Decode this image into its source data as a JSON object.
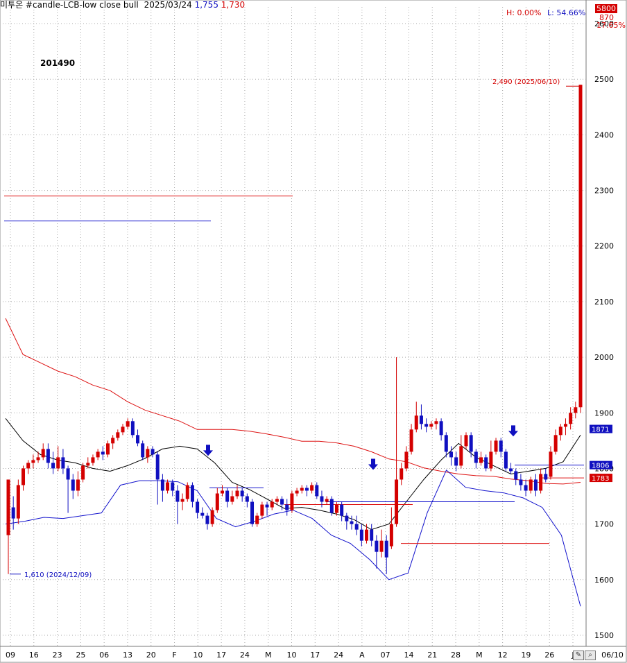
{
  "header": {
    "title": "미투온 #candle-LCB-low close bull",
    "date": "2025/03/24",
    "price1": "1,755",
    "price2": "1,730"
  },
  "code": "201490",
  "stats": {
    "high": "H: 0.00%",
    "low": "L: 54.66%",
    "pct": "17.65%",
    "val_5800": "5800",
    "val_870": "870"
  },
  "annotations": {
    "max_label": "2,490 (2025/06/10)",
    "min_label": "1,610 (2024/12/09)"
  },
  "right_tags": {
    "tag1871": "1871",
    "tag1806": "1806",
    "tag1783": "1783"
  },
  "colors": {
    "up": "#d40000",
    "down": "#1010c0",
    "upper_band": "#dd1111",
    "lower_band": "#1111cc",
    "mid_line": "#000000",
    "grid": "#aaaaaa"
  },
  "chart_data": {
    "type": "candlestick",
    "ylim": [
      1480,
      2630
    ],
    "yticks": [
      1500,
      1600,
      1700,
      1800,
      1900,
      2000,
      2100,
      2200,
      2300,
      2400,
      2500,
      2600
    ],
    "xticks": [
      "09",
      "16",
      "23",
      "25",
      "06",
      "13",
      "20",
      "F",
      "10",
      "17",
      "24",
      "M",
      "10",
      "17",
      "24",
      "A",
      "07",
      "14",
      "21",
      "28",
      "M",
      "12",
      "19",
      "26",
      "J",
      "06/10"
    ],
    "candles": [
      [
        1680,
        1780,
        1610,
        1780
      ],
      [
        1730,
        1710,
        1690,
        1750
      ],
      [
        1710,
        1770,
        1700,
        1780
      ],
      [
        1770,
        1800,
        1760,
        1805
      ],
      [
        1800,
        1810,
        1790,
        1815
      ],
      [
        1810,
        1815,
        1800,
        1825
      ],
      [
        1815,
        1820,
        1810,
        1830
      ],
      [
        1820,
        1835,
        1815,
        1845
      ],
      [
        1835,
        1810,
        1800,
        1845
      ],
      [
        1810,
        1800,
        1790,
        1830
      ],
      [
        1800,
        1820,
        1795,
        1840
      ],
      [
        1820,
        1800,
        1790,
        1835
      ],
      [
        1800,
        1780,
        1720,
        1805
      ],
      [
        1780,
        1760,
        1745,
        1790
      ],
      [
        1760,
        1780,
        1750,
        1795
      ],
      [
        1780,
        1805,
        1775,
        1810
      ],
      [
        1805,
        1810,
        1800,
        1820
      ],
      [
        1810,
        1820,
        1805,
        1825
      ],
      [
        1820,
        1830,
        1815,
        1835
      ],
      [
        1830,
        1825,
        1815,
        1840
      ],
      [
        1825,
        1845,
        1820,
        1850
      ],
      [
        1845,
        1855,
        1835,
        1860
      ],
      [
        1855,
        1865,
        1850,
        1870
      ],
      [
        1865,
        1875,
        1860,
        1880
      ],
      [
        1875,
        1885,
        1870,
        1890
      ],
      [
        1885,
        1860,
        1855,
        1890
      ],
      [
        1860,
        1845,
        1840,
        1870
      ],
      [
        1845,
        1820,
        1815,
        1850
      ],
      [
        1820,
        1835,
        1810,
        1840
      ],
      [
        1835,
        1825,
        1820,
        1840
      ],
      [
        1825,
        1780,
        1735,
        1830
      ],
      [
        1780,
        1760,
        1740,
        1790
      ],
      [
        1760,
        1775,
        1755,
        1780
      ],
      [
        1775,
        1760,
        1750,
        1780
      ],
      [
        1760,
        1740,
        1700,
        1770
      ],
      [
        1740,
        1745,
        1725,
        1755
      ],
      [
        1745,
        1770,
        1740,
        1775
      ],
      [
        1770,
        1740,
        1730,
        1775
      ],
      [
        1740,
        1720,
        1710,
        1745
      ],
      [
        1720,
        1715,
        1710,
        1730
      ],
      [
        1715,
        1700,
        1690,
        1720
      ],
      [
        1700,
        1725,
        1695,
        1730
      ],
      [
        1725,
        1755,
        1720,
        1765
      ],
      [
        1755,
        1760,
        1750,
        1770
      ],
      [
        1760,
        1740,
        1730,
        1765
      ],
      [
        1740,
        1750,
        1735,
        1760
      ],
      [
        1750,
        1760,
        1745,
        1770
      ],
      [
        1760,
        1750,
        1740,
        1765
      ],
      [
        1750,
        1740,
        1730,
        1755
      ],
      [
        1740,
        1700,
        1695,
        1745
      ],
      [
        1700,
        1715,
        1695,
        1720
      ],
      [
        1715,
        1735,
        1710,
        1740
      ],
      [
        1735,
        1730,
        1715,
        1740
      ],
      [
        1730,
        1740,
        1725,
        1745
      ],
      [
        1740,
        1745,
        1735,
        1750
      ],
      [
        1745,
        1735,
        1725,
        1750
      ],
      [
        1735,
        1725,
        1715,
        1745
      ],
      [
        1725,
        1755,
        1720,
        1760
      ],
      [
        1755,
        1760,
        1750,
        1765
      ],
      [
        1760,
        1765,
        1755,
        1770
      ],
      [
        1765,
        1760,
        1750,
        1770
      ],
      [
        1760,
        1770,
        1755,
        1775
      ],
      [
        1770,
        1750,
        1745,
        1775
      ],
      [
        1750,
        1740,
        1730,
        1760
      ],
      [
        1740,
        1745,
        1735,
        1750
      ],
      [
        1745,
        1720,
        1715,
        1750
      ],
      [
        1720,
        1735,
        1715,
        1740
      ],
      [
        1735,
        1715,
        1705,
        1740
      ],
      [
        1715,
        1705,
        1690,
        1720
      ],
      [
        1705,
        1700,
        1690,
        1715
      ],
      [
        1700,
        1690,
        1680,
        1715
      ],
      [
        1690,
        1670,
        1660,
        1700
      ],
      [
        1670,
        1690,
        1665,
        1700
      ],
      [
        1690,
        1670,
        1660,
        1700
      ],
      [
        1670,
        1650,
        1620,
        1680
      ],
      [
        1650,
        1670,
        1640,
        1690
      ],
      [
        1670,
        1640,
        1610,
        1680
      ],
      [
        1660,
        1700,
        1655,
        1730
      ],
      [
        1700,
        1780,
        1695,
        2000
      ],
      [
        1780,
        1800,
        1770,
        1810
      ],
      [
        1800,
        1830,
        1795,
        1840
      ],
      [
        1830,
        1870,
        1825,
        1880
      ],
      [
        1870,
        1895,
        1865,
        1920
      ],
      [
        1895,
        1880,
        1870,
        1915
      ],
      [
        1880,
        1875,
        1865,
        1890
      ],
      [
        1875,
        1880,
        1870,
        1885
      ],
      [
        1880,
        1885,
        1870,
        1890
      ],
      [
        1885,
        1860,
        1850,
        1890
      ],
      [
        1860,
        1830,
        1820,
        1865
      ],
      [
        1830,
        1820,
        1805,
        1840
      ],
      [
        1820,
        1805,
        1795,
        1830
      ],
      [
        1805,
        1840,
        1800,
        1860
      ],
      [
        1840,
        1860,
        1835,
        1865
      ],
      [
        1860,
        1830,
        1820,
        1865
      ],
      [
        1830,
        1810,
        1800,
        1835
      ],
      [
        1810,
        1820,
        1805,
        1830
      ],
      [
        1820,
        1800,
        1795,
        1825
      ],
      [
        1800,
        1830,
        1795,
        1850
      ],
      [
        1830,
        1850,
        1825,
        1855
      ],
      [
        1850,
        1830,
        1820,
        1855
      ],
      [
        1830,
        1800,
        1795,
        1835
      ],
      [
        1800,
        1795,
        1790,
        1810
      ],
      [
        1795,
        1780,
        1770,
        1800
      ],
      [
        1780,
        1770,
        1760,
        1790
      ],
      [
        1770,
        1760,
        1750,
        1780
      ],
      [
        1760,
        1780,
        1755,
        1785
      ],
      [
        1780,
        1760,
        1750,
        1790
      ],
      [
        1760,
        1790,
        1755,
        1800
      ],
      [
        1790,
        1780,
        1775,
        1800
      ],
      [
        1785,
        1830,
        1780,
        1840
      ],
      [
        1830,
        1860,
        1825,
        1870
      ],
      [
        1860,
        1875,
        1850,
        1880
      ],
      [
        1875,
        1880,
        1860,
        1890
      ],
      [
        1880,
        1900,
        1870,
        1910
      ],
      [
        1900,
        1910,
        1890,
        1920
      ],
      [
        1910,
        2490,
        1900,
        2490
      ]
    ],
    "bands": {
      "upper": [
        2070,
        2005,
        1990,
        1975,
        1965,
        1950,
        1940,
        1920,
        1905,
        1895,
        1885,
        1870,
        1870,
        1870,
        1867,
        1862,
        1856,
        1849,
        1849,
        1846,
        1840,
        1830,
        1817,
        1812,
        1801,
        1795,
        1790,
        1787,
        1786,
        1781,
        1778,
        1773,
        1772,
        1775
      ],
      "mid": [
        1890,
        1850,
        1825,
        1815,
        1810,
        1800,
        1795,
        1805,
        1818,
        1835,
        1840,
        1835,
        1810,
        1775,
        1762,
        1745,
        1728,
        1730,
        1725,
        1718,
        1708,
        1690,
        1700,
        1740,
        1780,
        1815,
        1845,
        1820,
        1805,
        1790,
        1795,
        1800,
        1812,
        1860
      ],
      "lower": [
        1700,
        1705,
        1712,
        1710,
        1715,
        1720,
        1770,
        1778,
        1778,
        1776,
        1760,
        1710,
        1695,
        1705,
        1718,
        1725,
        1710,
        1680,
        1665,
        1636,
        1600,
        1612,
        1720,
        1797,
        1766,
        1760,
        1756,
        1747,
        1730,
        1680,
        1552
      ]
    },
    "hlines": [
      {
        "y": 2290,
        "color": "#dd1111"
      },
      {
        "y": 2245,
        "color": "#1111cc"
      },
      {
        "y": 1765,
        "color": "#1111cc"
      },
      {
        "y": 1735,
        "color": "#dd1111"
      },
      {
        "y": 1740,
        "color": "#1111cc"
      },
      {
        "y": 1665,
        "color": "#dd1111"
      },
      {
        "y": 1806,
        "color": "#1111cc"
      },
      {
        "y": 1783,
        "color": "#dd1111"
      }
    ],
    "arrows": [
      1805,
      1780,
      1840
    ]
  }
}
